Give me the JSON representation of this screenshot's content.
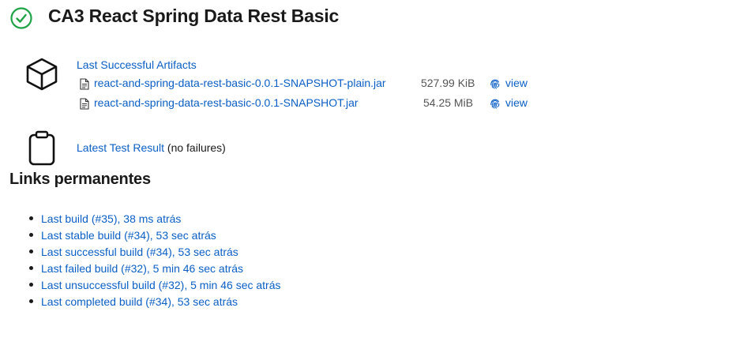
{
  "header": {
    "title": "CA3 React Spring Data Rest Basic",
    "status_icon": "check-circle-icon",
    "status_color": "#1ea446"
  },
  "artifacts": {
    "heading": "Last Successful Artifacts",
    "icon": "package-box-icon",
    "items": [
      {
        "name": "react-and-spring-data-rest-basic-0.0.1-SNAPSHOT-plain.jar",
        "size": "527.99 KiB",
        "view_label": "view"
      },
      {
        "name": "react-and-spring-data-rest-basic-0.0.1-SNAPSHOT.jar",
        "size": "54.25 MiB",
        "view_label": "view"
      }
    ]
  },
  "test_result": {
    "link_label": "Latest Test Result",
    "suffix": " (no failures)",
    "icon": "clipboard-icon"
  },
  "permalinks": {
    "heading": "Links permanentes",
    "items": [
      {
        "label": "Last build (#35), 38 ms atrás"
      },
      {
        "label": "Last stable build (#34), 53 sec atrás"
      },
      {
        "label": "Last successful build (#34), 53 sec atrás"
      },
      {
        "label": "Last failed build (#32), 5 min 46 sec atrás"
      },
      {
        "label": "Last unsuccessful build (#32), 5 min 46 sec atrás"
      },
      {
        "label": "Last completed build (#34), 53 sec atrás"
      }
    ]
  },
  "colors": {
    "link": "#0b5fc6",
    "text": "#1a1a1a",
    "success": "#1ea446"
  }
}
